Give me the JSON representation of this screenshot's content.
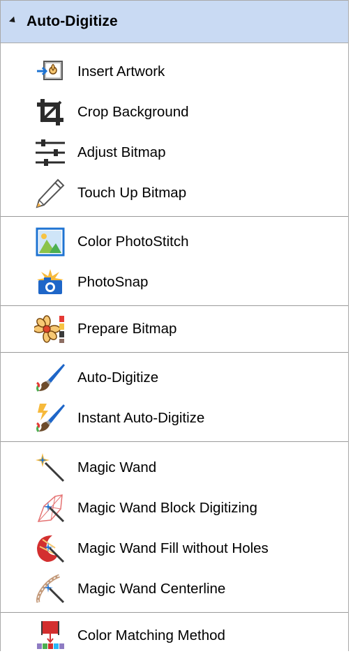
{
  "panel": {
    "header": {
      "title": "Auto-Digitize",
      "expander": "collapse-triangle-icon"
    },
    "groups": [
      {
        "items": [
          {
            "label": "Insert Artwork",
            "icon": "insert-artwork-icon"
          },
          {
            "label": "Crop Background",
            "icon": "crop-icon"
          },
          {
            "label": "Adjust Bitmap",
            "icon": "sliders-icon"
          },
          {
            "label": "Touch Up Bitmap",
            "icon": "pencil-icon"
          }
        ]
      },
      {
        "items": [
          {
            "label": "Color PhotoStitch",
            "icon": "landscape-photo-icon"
          },
          {
            "label": "PhotoSnap",
            "icon": "camera-flash-icon"
          }
        ]
      },
      {
        "items": [
          {
            "label": "Prepare Bitmap",
            "icon": "flower-palette-icon"
          }
        ]
      },
      {
        "items": [
          {
            "label": "Auto-Digitize",
            "icon": "paintbrush-icon"
          },
          {
            "label": "Instant Auto-Digitize",
            "icon": "lightning-paintbrush-icon"
          }
        ]
      },
      {
        "items": [
          {
            "label": "Magic Wand",
            "icon": "magic-wand-icon"
          },
          {
            "label": "Magic Wand Block Digitizing",
            "icon": "magic-wand-block-icon"
          },
          {
            "label": "Magic Wand Fill without Holes",
            "icon": "magic-wand-fill-icon"
          },
          {
            "label": "Magic Wand Centerline",
            "icon": "magic-wand-centerline-icon"
          }
        ]
      },
      {
        "items": [
          {
            "label": "Color Matching Method",
            "icon": "color-matching-icon"
          }
        ]
      }
    ]
  }
}
